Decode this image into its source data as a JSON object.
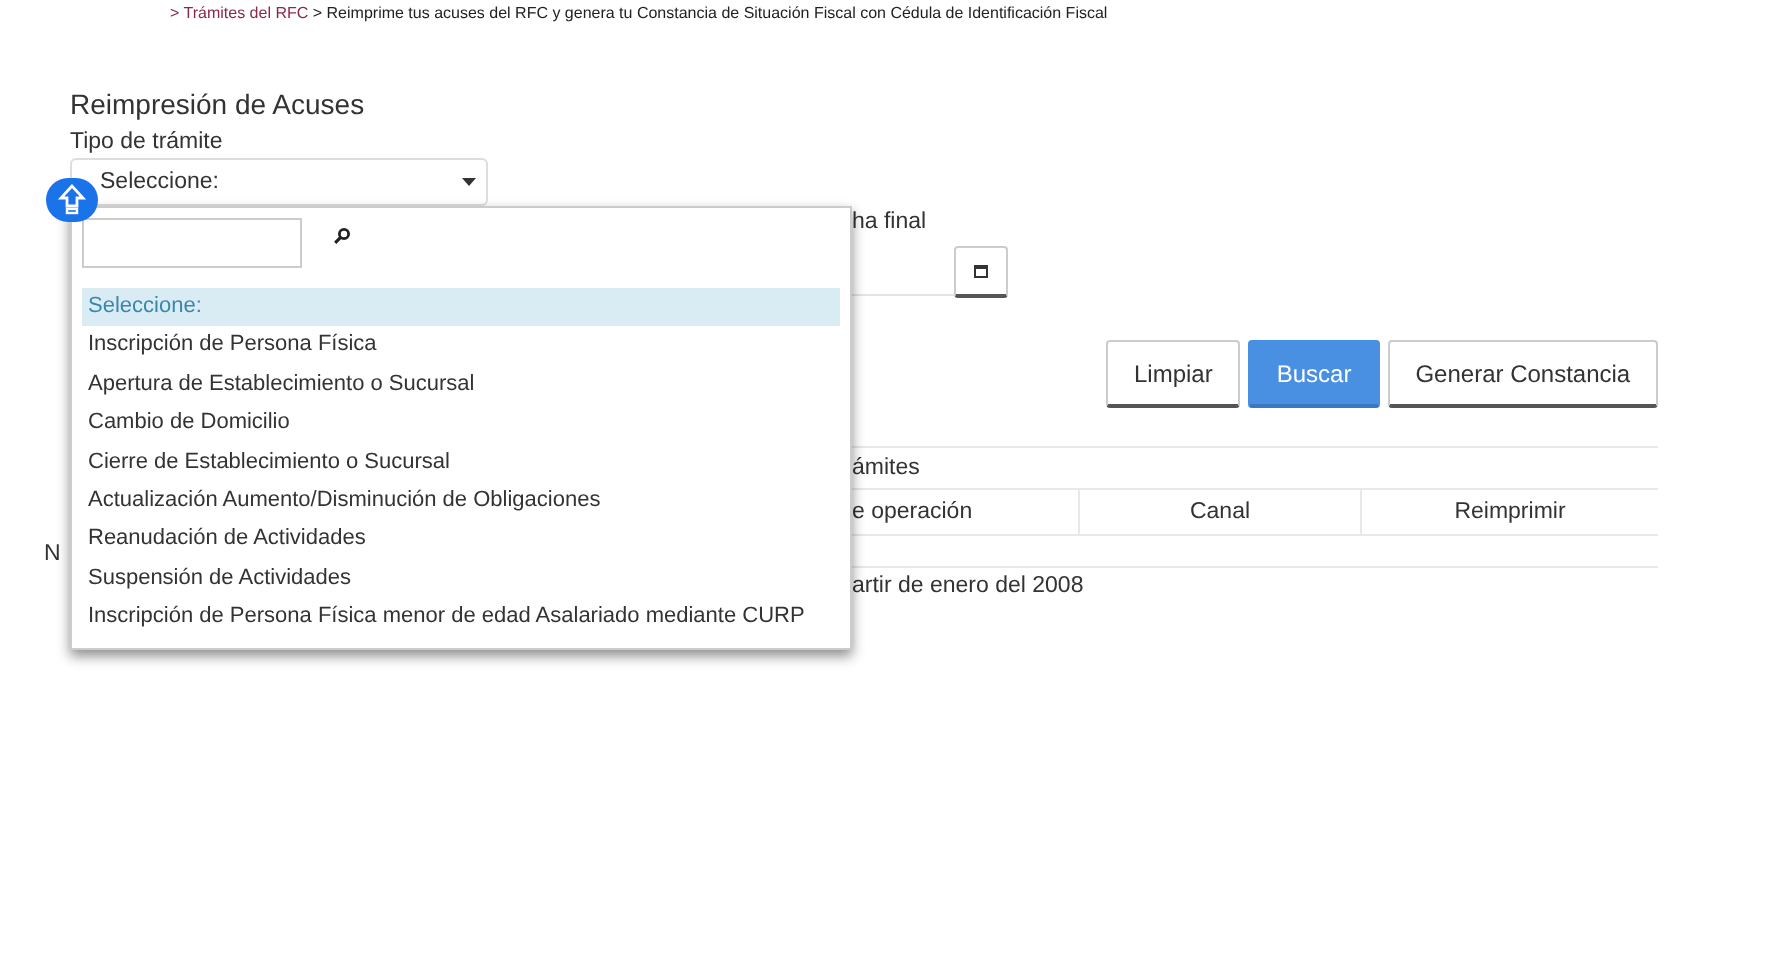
{
  "breadcrumb": {
    "separator_1": ">",
    "link": "Trámites del RFC",
    "separator_2": ">",
    "current": "Reimprime tus acuses del RFC y genera tu Constancia de Situación Fiscal con Cédula de Identificación Fiscal"
  },
  "title": "Reimpresión de Acuses",
  "tipo_tramite": {
    "label": "Tipo de trámite",
    "value": "Seleccione:"
  },
  "fecha_final": {
    "label": "ha final"
  },
  "buttons": [
    {
      "label": "Limpiar",
      "kind": "default"
    },
    {
      "label": "Buscar",
      "kind": "primary"
    },
    {
      "label": "Generar Constancia",
      "kind": "default"
    }
  ],
  "results": {
    "title": "ámites",
    "columns": [
      "e operación",
      "Canal",
      "Reimprimir"
    ],
    "side_text": "N",
    "note": "artir de enero del 2008"
  },
  "dropdown": {
    "options": [
      {
        "label": "Seleccione:",
        "selected": true
      },
      {
        "label": "Inscripción de Persona Física",
        "selected": false
      },
      {
        "label": "Apertura de Establecimiento o Sucursal",
        "selected": false
      },
      {
        "label": "Cambio de Domicilio",
        "selected": false
      },
      {
        "label": "Cierre de Establecimiento o Sucursal",
        "selected": false
      },
      {
        "label": "Actualización Aumento/Disminución de Obligaciones",
        "selected": false
      },
      {
        "label": "Reanudación de Actividades",
        "selected": false
      },
      {
        "label": "Suspensión de Actividades",
        "selected": false
      },
      {
        "label": "Inscripción de Persona Física menor de edad Asalariado mediante CURP",
        "selected": false
      }
    ]
  }
}
